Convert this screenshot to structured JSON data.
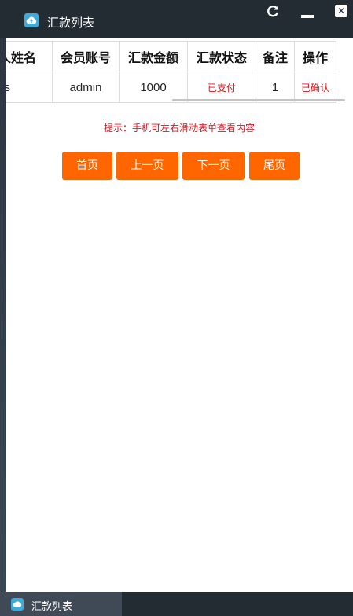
{
  "window": {
    "title": "汇款列表",
    "icon": "cloud-icon",
    "controls": {
      "refresh": "refresh-icon",
      "minimize": "minimize-icon",
      "close": "close-icon"
    }
  },
  "table": {
    "headers": [
      "人姓名",
      "会员账号",
      "汇款金额",
      "汇款状态",
      "备注",
      "操作"
    ],
    "rows": [
      [
        "cs",
        "admin",
        "1000",
        "已支付",
        "1",
        "已确认"
      ]
    ]
  },
  "hint": "提示：手机可左右滑动表单查看内容",
  "pager": {
    "first": "首页",
    "prev": "上一页",
    "next": "下一页",
    "last": "尾页"
  },
  "taskbar": {
    "item_label": "汇款列表"
  },
  "colors": {
    "accent": "#ff6600",
    "status_red": "#e0121b",
    "titlebar": "#232b33"
  }
}
